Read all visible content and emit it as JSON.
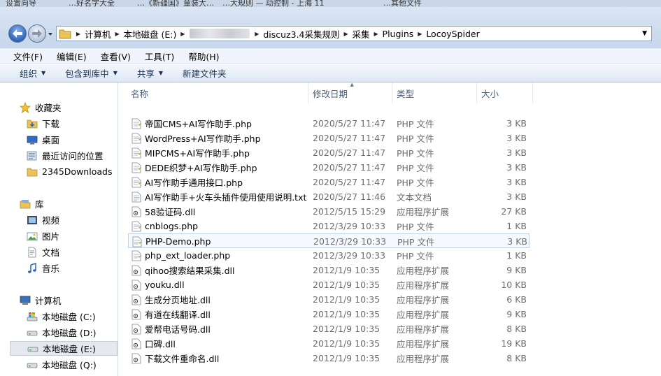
{
  "taskbar_tabs": [
    "设置向导",
    "…好名字大全",
    "…《新疆国》童装大…",
    "…大规则 — 动控制 - 上海 11",
    "…其他文件"
  ],
  "nav": {
    "breadcrumb": [
      "计算机",
      "本地磁盘 (E:)",
      "discuz3.4采集规则",
      "采集",
      "Plugins",
      "LocoySpider"
    ]
  },
  "menu": [
    "文件(F)",
    "编辑(E)",
    "查看(V)",
    "工具(T)",
    "帮助(H)"
  ],
  "toolbar": [
    {
      "label": "组织",
      "dropdown": true
    },
    {
      "label": "包含到库中",
      "dropdown": true
    },
    {
      "label": "共享",
      "dropdown": true
    },
    {
      "label": "新建文件夹",
      "dropdown": false
    }
  ],
  "sidebar": {
    "favorites_label": "收藏夹",
    "favorites": [
      {
        "label": "下载",
        "icon": "download-folder-icon"
      },
      {
        "label": "桌面",
        "icon": "desktop-icon"
      },
      {
        "label": "最近访问的位置",
        "icon": "recent-places-icon"
      },
      {
        "label": "2345Downloads",
        "icon": "folder-icon"
      }
    ],
    "libraries_label": "库",
    "libraries": [
      {
        "label": "视频",
        "icon": "video-icon"
      },
      {
        "label": "图片",
        "icon": "picture-icon"
      },
      {
        "label": "文档",
        "icon": "document-icon"
      },
      {
        "label": "音乐",
        "icon": "music-icon"
      }
    ],
    "computer_label": "计算机",
    "drives": [
      {
        "label": "本地磁盘 (C:)",
        "icon": "system-drive-icon",
        "selected": false
      },
      {
        "label": "本地磁盘 (D:)",
        "icon": "drive-icon",
        "selected": false
      },
      {
        "label": "本地磁盘 (E:)",
        "icon": "drive-icon",
        "selected": true
      },
      {
        "label": "本地磁盘 (Q:)",
        "icon": "drive-icon",
        "selected": false
      }
    ]
  },
  "columns": {
    "name": "名称",
    "date": "修改日期",
    "type": "类型",
    "size": "大小"
  },
  "files": [
    {
      "name": "帝国CMS+AI写作助手.php",
      "date": "2020/5/27 11:47",
      "type": "PHP 文件",
      "size": "3 KB",
      "icon": "php"
    },
    {
      "name": "WordPress+AI写作助手.php",
      "date": "2020/5/27 11:47",
      "type": "PHP 文件",
      "size": "3 KB",
      "icon": "php"
    },
    {
      "name": "MIPCMS+AI写作助手.php",
      "date": "2020/5/27 11:47",
      "type": "PHP 文件",
      "size": "3 KB",
      "icon": "php"
    },
    {
      "name": "DEDE织梦+AI写作助手.php",
      "date": "2020/5/27 11:47",
      "type": "PHP 文件",
      "size": "3 KB",
      "icon": "php"
    },
    {
      "name": "AI写作助手通用接口.php",
      "date": "2020/5/27 11:47",
      "type": "PHP 文件",
      "size": "3 KB",
      "icon": "php"
    },
    {
      "name": "AI写作助手+火车头插件使用使用说明.txt",
      "date": "2020/5/27 11:46",
      "type": "文本文档",
      "size": "3 KB",
      "icon": "txt"
    },
    {
      "name": "58验证码.dll",
      "date": "2012/5/15 15:29",
      "type": "应用程序扩展",
      "size": "27 KB",
      "icon": "dll"
    },
    {
      "name": "cnblogs.php",
      "date": "2012/3/29 10:33",
      "type": "PHP 文件",
      "size": "1 KB",
      "icon": "php"
    },
    {
      "name": "PHP-Demo.php",
      "date": "2012/3/29 10:33",
      "type": "PHP 文件",
      "size": "3 KB",
      "icon": "php"
    },
    {
      "name": "php_ext_loader.php",
      "date": "2012/3/29 10:33",
      "type": "PHP 文件",
      "size": "1 KB",
      "icon": "php"
    },
    {
      "name": "qihoo搜索结果采集.dll",
      "date": "2012/1/9 10:35",
      "type": "应用程序扩展",
      "size": "9 KB",
      "icon": "dll"
    },
    {
      "name": "youku.dll",
      "date": "2012/1/9 10:35",
      "type": "应用程序扩展",
      "size": "10 KB",
      "icon": "dll"
    },
    {
      "name": "生成分页地址.dll",
      "date": "2012/1/9 10:35",
      "type": "应用程序扩展",
      "size": "6 KB",
      "icon": "dll"
    },
    {
      "name": "有道在线翻译.dll",
      "date": "2012/1/9 10:35",
      "type": "应用程序扩展",
      "size": "9 KB",
      "icon": "dll"
    },
    {
      "name": "爱帮电话号码.dll",
      "date": "2012/1/9 10:35",
      "type": "应用程序扩展",
      "size": "8 KB",
      "icon": "dll"
    },
    {
      "name": "口碑.dll",
      "date": "2012/1/9 10:35",
      "type": "应用程序扩展",
      "size": "19 KB",
      "icon": "dll"
    },
    {
      "name": "下载文件重命名.dll",
      "date": "2012/1/9 10:35",
      "type": "应用程序扩展",
      "size": "8 KB",
      "icon": "dll"
    }
  ],
  "selected_file": "PHP-Demo.php",
  "colors": {
    "accent": "#2e63b5",
    "selection": "#bcd3ea",
    "chrome": "#cad9ec"
  }
}
